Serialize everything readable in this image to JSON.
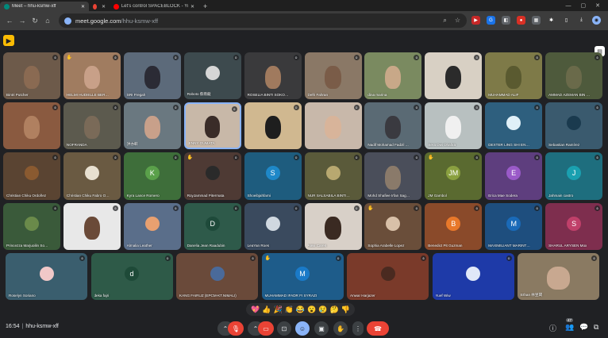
{
  "browser": {
    "tabs": [
      {
        "title": "Meet – hhu-ksmw-xff",
        "active": true,
        "favicon_color": "#00897b"
      },
      {
        "title": "",
        "active": false,
        "favicon_color": "#ea4335"
      },
      {
        "title": "Let's control SPACEBLOCK - Yo",
        "active": false,
        "favicon_color": "#ff0000"
      }
    ],
    "url_host": "meet.google.com",
    "url_path": "/hhu-ksmw-xff"
  },
  "participants": [
    {
      "name": "Bintri Putcher",
      "bg": "#6d5a4a",
      "row": 0,
      "col": 0,
      "kind": "video",
      "face": "#8a6a52"
    },
    {
      "name": "HELMI HUDIELLE BERT KEI...",
      "bg": "#a07c60",
      "row": 0,
      "col": 1,
      "kind": "video",
      "face": "#c8a088",
      "hand": true
    },
    {
      "name": "SRI Fregah",
      "bg": "#5c6a7a",
      "row": 0,
      "col": 2,
      "kind": "video",
      "face": "#2b2b35"
    },
    {
      "name": "Roboto 蔡雨龍",
      "bg": "#3d4a4e",
      "row": 0,
      "col": 3,
      "kind": "avatar",
      "color": "#d6d6d6",
      "initial": ""
    },
    {
      "name": "ROSELIA BINTI SOKODINATA",
      "bg": "#3a3a3c",
      "row": 0,
      "col": 4,
      "kind": "video",
      "face": "#a07a5e"
    },
    {
      "name": "Defri Fahran",
      "bg": "#8a7866",
      "row": 0,
      "col": 5,
      "kind": "video",
      "face": "#7a5c48"
    },
    {
      "name": "dina marina",
      "bg": "#7a8a60",
      "row": 0,
      "col": 6,
      "kind": "video",
      "face": "#c8a888"
    },
    {
      "name": "",
      "bg": "#d8d0c4",
      "row": 0,
      "col": 7,
      "kind": "video",
      "face": "#2b2b2b"
    },
    {
      "name": "MUHAMMAD ALIF",
      "bg": "#7e7a48",
      "row": 0,
      "col": 8,
      "kind": "video",
      "face": "#5a5a30"
    },
    {
      "name": "AMMAD AZEMAN BIN BA...",
      "bg": "#4e5a3c",
      "row": 0,
      "col": 9,
      "kind": "video",
      "face": "#6a6a4a"
    },
    {
      "name": "",
      "bg": "#8a5a40",
      "row": 1,
      "col": 0,
      "kind": "video",
      "face": "#b08060"
    },
    {
      "name": "NOFRANDA",
      "bg": "#5c5a4e",
      "row": 1,
      "col": 1,
      "kind": "video",
      "face": "#7a6a58"
    },
    {
      "name": "洪亦軒",
      "bg": "#6a7880",
      "row": 1,
      "col": 2,
      "kind": "video",
      "face": "#c8a08a"
    },
    {
      "name": "ENNY GUMATA",
      "bg": "#c8b8a8",
      "row": 1,
      "col": 3,
      "kind": "video",
      "face": "#3a2c28",
      "speaking": true
    },
    {
      "name": "",
      "bg": "#d0b890",
      "row": 1,
      "col": 4,
      "kind": "video",
      "face": "#1e1e1e"
    },
    {
      "name": "",
      "bg": "#c8b8aa",
      "row": 1,
      "col": 5,
      "kind": "video",
      "face": "#d8b49a"
    },
    {
      "name": "Nadif Mohamad Fadzil Abd...",
      "bg": "#5a6a74",
      "row": 1,
      "col": 6,
      "kind": "video",
      "face": "#3a3a40"
    },
    {
      "name": "Sera Dwi Dhafira",
      "bg": "#b8c0c0",
      "row": 1,
      "col": 7,
      "kind": "video",
      "face": "#f0f0f0"
    },
    {
      "name": "DEXTER LING SHI ENG (FG...",
      "bg": "#2e5f7e",
      "row": 1,
      "col": 8,
      "kind": "avatar",
      "color": "#e0f0f8",
      "initial": ""
    },
    {
      "name": "Sebastian Ramírez",
      "bg": "#3a5a6e",
      "row": 1,
      "col": 9,
      "kind": "avatar",
      "color": "#1a3a4e",
      "initial": ""
    },
    {
      "name": "Christian Chiku Ordoñez",
      "bg": "#5a4432",
      "row": 2,
      "col": 0,
      "kind": "avatar",
      "color": "#8a5a30",
      "initial": ""
    },
    {
      "name": "Christian Chiku Fabro Ordi...",
      "bg": "#6a5a42",
      "row": 2,
      "col": 1,
      "kind": "avatar",
      "color": "#e8e0d0",
      "initial": ""
    },
    {
      "name": "Kyra Lance Romero",
      "bg": "#3e6e3a",
      "row": 2,
      "col": 2,
      "kind": "avatar",
      "color": "#5aa04a",
      "initial": "K"
    },
    {
      "name": "RoyJammad Pitermata",
      "bg": "#4e3a34",
      "row": 2,
      "col": 3,
      "kind": "avatar",
      "color": "#2a2a2a",
      "initial": "",
      "hand": true
    },
    {
      "name": "Shoeibjahfarni",
      "bg": "#1e5c7e",
      "row": 2,
      "col": 4,
      "kind": "avatar",
      "color": "#1e88c8",
      "initial": "S"
    },
    {
      "name": "NUR SALSABILA BINTI SA...",
      "bg": "#5a5a3a",
      "row": 2,
      "col": 5,
      "kind": "avatar",
      "color": "#b8a870",
      "initial": ""
    },
    {
      "name": "Mohd Shafiee Irfan Sagala...",
      "bg": "#4a4e5a",
      "row": 2,
      "col": 6,
      "kind": "video",
      "face": "#8a7a6a"
    },
    {
      "name": "JM Gambol",
      "bg": "#5a6a30",
      "row": 2,
      "col": 7,
      "kind": "avatar",
      "color": "#8aa040",
      "initial": "JM",
      "hand": true
    },
    {
      "name": "Erica Mae Sodera",
      "bg": "#5e3e7e",
      "row": 2,
      "col": 8,
      "kind": "avatar",
      "color": "#9a5ac8",
      "initial": "E"
    },
    {
      "name": "Jahmain castro",
      "bg": "#1e6e7e",
      "row": 2,
      "col": 9,
      "kind": "avatar",
      "color": "#1aa0b0",
      "initial": "J"
    },
    {
      "name": "Princezza Marjuoilin Sodera",
      "bg": "#3a5a3a",
      "row": 3,
      "col": 0,
      "kind": "avatar",
      "color": "#6a8a4a",
      "initial": ""
    },
    {
      "name": "",
      "bg": "#e8e8e8",
      "row": 3,
      "col": 1,
      "kind": "video",
      "face": "#6a4a38"
    },
    {
      "name": "Almalia Leather",
      "bg": "#5a6e8a",
      "row": 3,
      "col": 2,
      "kind": "avatar",
      "color": "#e8a070",
      "initial": ""
    },
    {
      "name": "Danelia Jean Raadubin",
      "bg": "#2e5a4a",
      "row": 3,
      "col": 3,
      "kind": "avatar",
      "color": "#1e4a3a",
      "initial": "D"
    },
    {
      "name": "LeaYan Roes",
      "bg": "#3a4a5e",
      "row": 3,
      "col": 4,
      "kind": "avatar",
      "color": "#d0d8e0",
      "initial": ""
    },
    {
      "name": "Alexi Caren",
      "bg": "#d8d0c8",
      "row": 3,
      "col": 5,
      "kind": "video",
      "face": "#3a2a22"
    },
    {
      "name": "Sophia Arabelle Lopez",
      "bg": "#6a4e3a",
      "row": 3,
      "col": 6,
      "kind": "avatar",
      "color": "#d8c0a8",
      "initial": "",
      "hand": true
    },
    {
      "name": "Benedict Pit Guzman",
      "bg": "#8a4a2a",
      "row": 3,
      "col": 7,
      "kind": "avatar",
      "color": "#e8782a",
      "initial": "B"
    },
    {
      "name": "MAXIMILIANT MARINTO...",
      "bg": "#1e4e7e",
      "row": 3,
      "col": 8,
      "kind": "avatar",
      "color": "#1a6ab8",
      "initial": "M"
    },
    {
      "name": "SHARUL ARYSEN Mox",
      "bg": "#7e2e4e",
      "row": 3,
      "col": 9,
      "kind": "avatar",
      "color": "#c0406a",
      "initial": "S"
    },
    {
      "name": "Roselyn Soriano",
      "bg": "#3a5e6e",
      "row": 4,
      "col": 0,
      "kind": "avatar",
      "color": "#f0c8c8",
      "initial": ""
    },
    {
      "name": "deka fajri",
      "bg": "#2e5a48",
      "row": 4,
      "col": 1,
      "kind": "avatar",
      "color": "#1e4a38",
      "initial": "d"
    },
    {
      "name": "KANG FAIRUZ (EPCM-KT.NIMALI)",
      "bg": "#6a4a3a",
      "row": 4,
      "col": 2,
      "kind": "avatar",
      "color": "#4a6a9a",
      "initial": ""
    },
    {
      "name": "MUHAMMAD IFADR FI SYRAZI",
      "bg": "#1e5c8a",
      "row": 4,
      "col": 3,
      "kind": "avatar",
      "color": "#1a7ac8",
      "initial": "M",
      "hand": true
    },
    {
      "name": "Anwar Harjazer",
      "bg": "#7a3a2a",
      "row": 4,
      "col": 4,
      "kind": "avatar",
      "color": "#4a2a20",
      "initial": ""
    },
    {
      "name": "Yuef Wiw",
      "bg": "#1e3aa8",
      "row": 4,
      "col": 5,
      "kind": "avatar",
      "color": "#e0e8f8",
      "initial": ""
    },
    {
      "name": "Ethan 林昱閎",
      "bg": "#8a7a62",
      "row": 4,
      "col": 6,
      "kind": "video",
      "face": "#c8a890"
    }
  ],
  "reactions": [
    "💖",
    "👍",
    "🎉",
    "👏",
    "😂",
    "😮",
    "😢",
    "🤔",
    "👎"
  ],
  "bottom": {
    "time": "16:54",
    "separator": "|",
    "meeting_code": "hhu-ksmw-xff",
    "people_count": "47"
  },
  "colors": {
    "end_call": "#ea4335",
    "active_reaction": "#8ab4f8",
    "speaking_border": "#8ab4f8"
  }
}
